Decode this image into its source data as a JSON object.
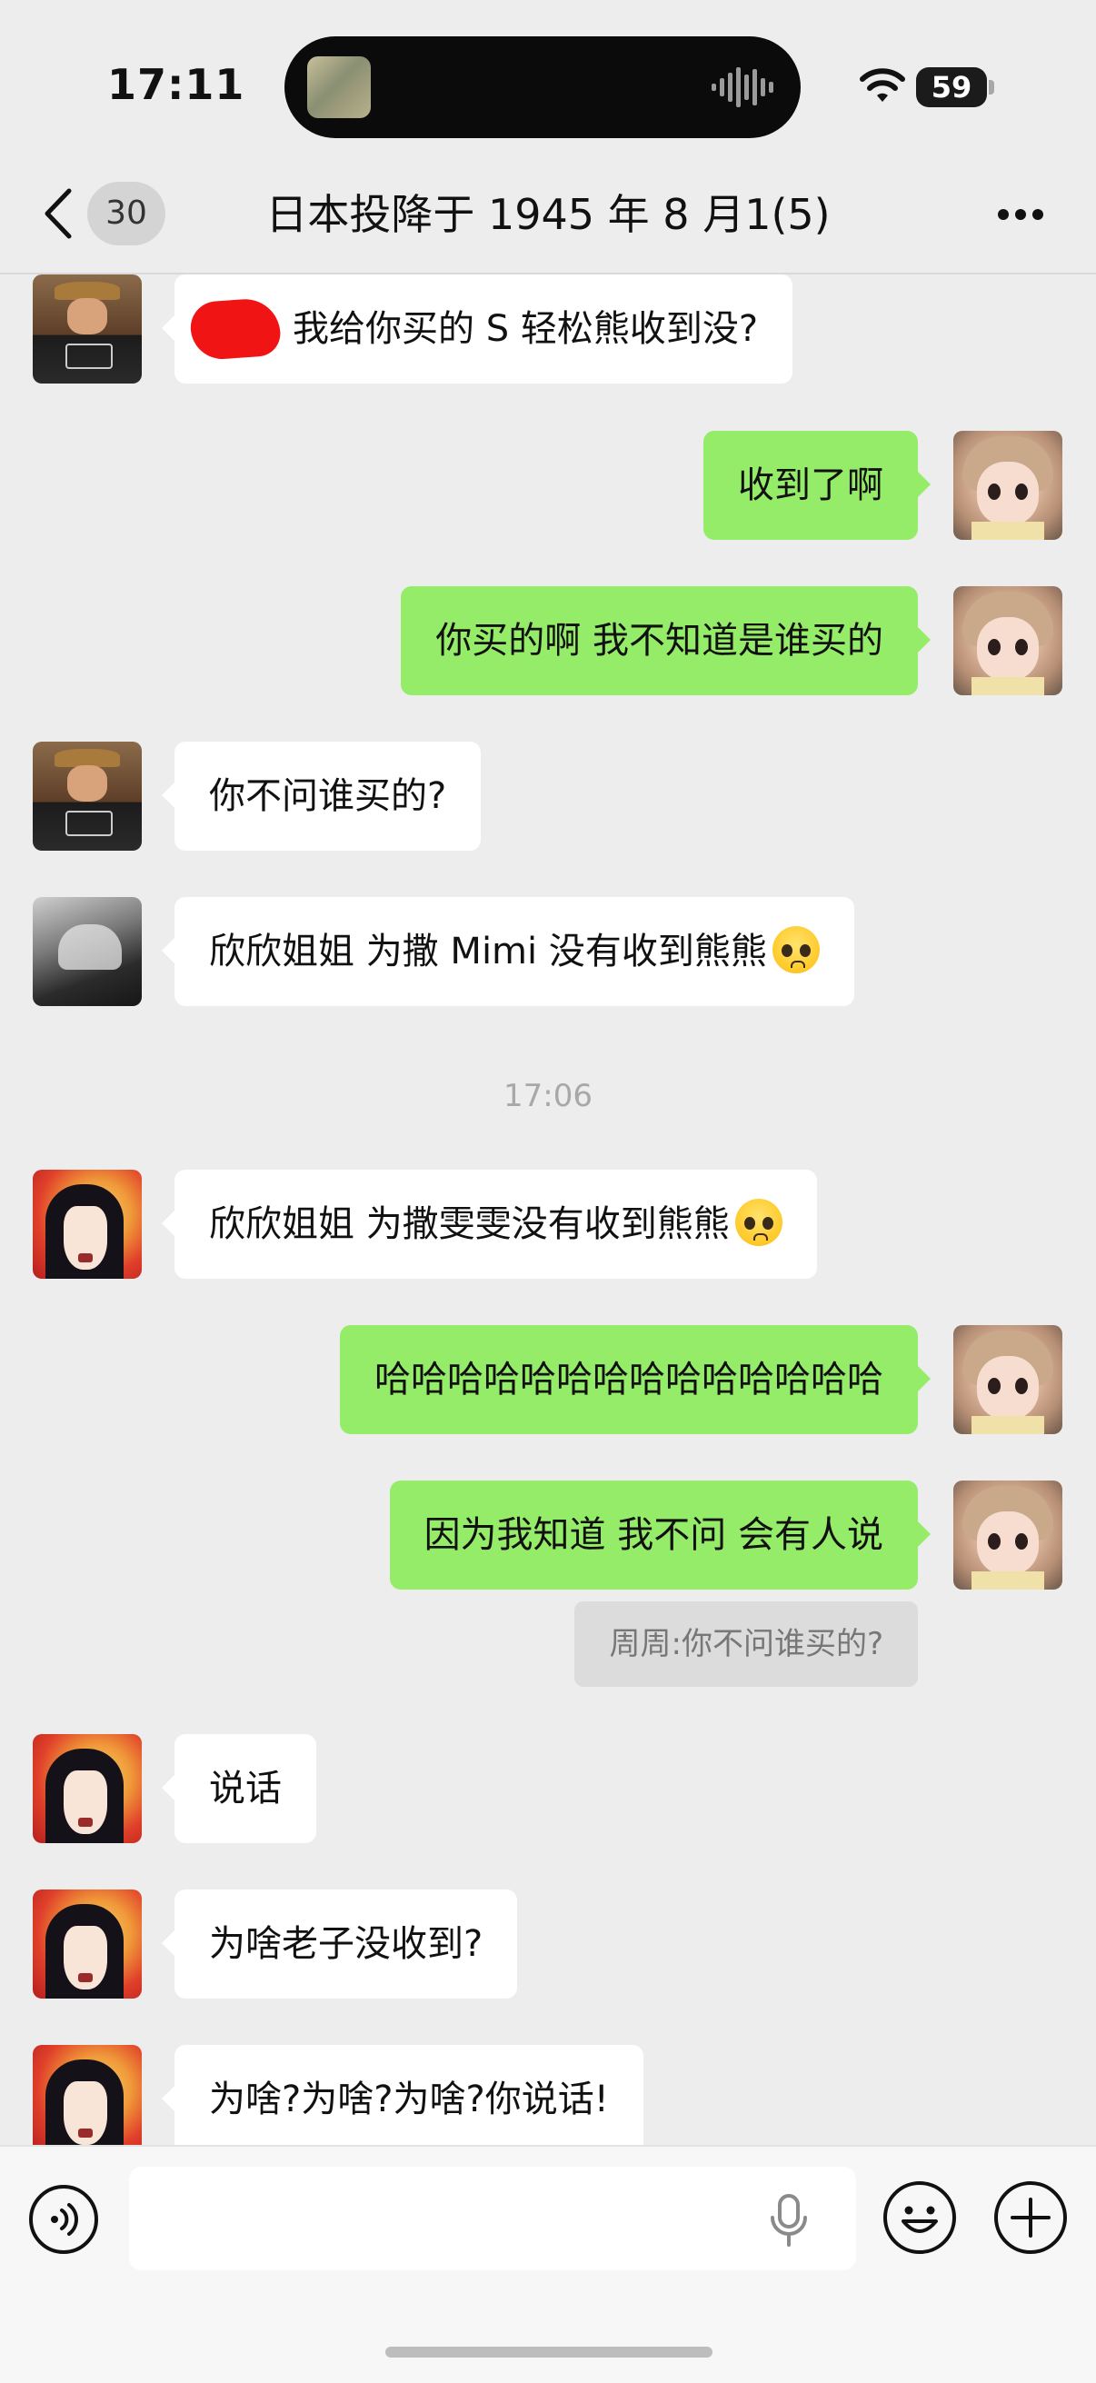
{
  "status_bar": {
    "time": "17:11",
    "battery": "59"
  },
  "nav": {
    "unread_count": "30",
    "title": "日本投降于 1945 年 8 月1(5)"
  },
  "messages": [
    {
      "side": "left",
      "avatar": "boy-hat-avatar",
      "text": "我给你买的 S 轻松熊收到没?",
      "redacted_prefix": true
    },
    {
      "side": "right",
      "avatar": "doll-avatar",
      "text": "收到了啊"
    },
    {
      "side": "right",
      "avatar": "doll-avatar",
      "text": "你买的啊 我不知道是谁买的"
    },
    {
      "side": "left",
      "avatar": "boy-hat-avatar",
      "text": "你不问谁买的?"
    },
    {
      "side": "left",
      "avatar": "dark-avatar",
      "text": "欣欣姐姐 为撒 Mimi 没有收到熊熊"
    },
    {
      "side": "left",
      "avatar": "anime-girl-avatar",
      "text": "欣欣姐姐 为撒雯雯没有收到熊熊"
    },
    {
      "side": "right",
      "avatar": "doll-avatar",
      "text": "哈哈哈哈哈哈哈哈哈哈哈哈哈哈"
    },
    {
      "side": "right",
      "avatar": "doll-avatar",
      "text": "因为我知道 我不问 会有人说"
    },
    {
      "side": "left",
      "avatar": "anime-girl-avatar",
      "text": "说话"
    },
    {
      "side": "left",
      "avatar": "anime-girl-avatar",
      "text": "为啥老子没收到?"
    },
    {
      "side": "left",
      "avatar": "anime-girl-avatar",
      "text": "为啥?为啥?为啥?你说话!"
    }
  ],
  "timestamp": "17:06",
  "quote": "周周:你不问谁买的?",
  "input": {
    "placeholder": ""
  },
  "colors": {
    "background": "#ededed",
    "incoming_bubble": "#ffffff",
    "outgoing_bubble": "#95ec69"
  }
}
